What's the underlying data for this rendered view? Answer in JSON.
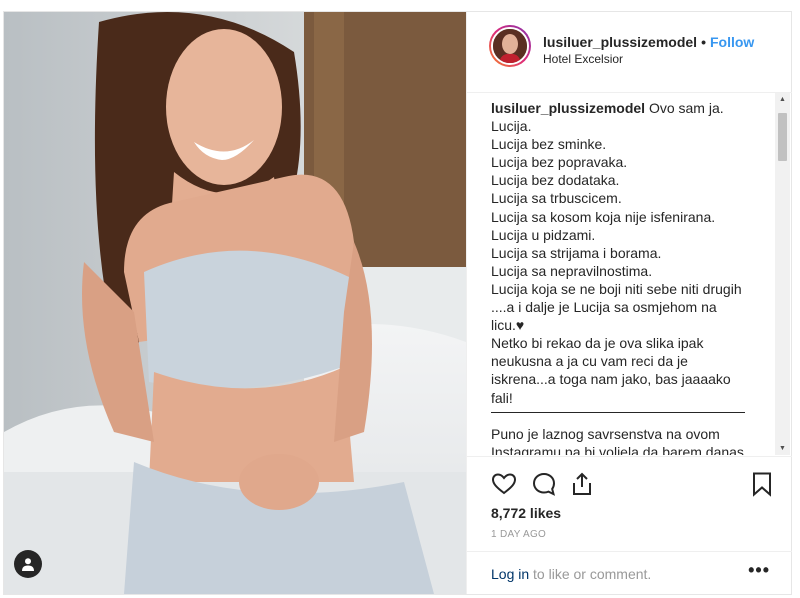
{
  "post": {
    "username": "lusiluer_plussizemodel",
    "separator": "•",
    "follow_label": "Follow",
    "location": "Hotel Excelsior",
    "caption_intro": "Ovo sam ja.",
    "caption_lines": [
      "Lucija.",
      "Lucija bez sminke.",
      "Lucija bez popravaka.",
      "Lucija bez dodataka.",
      "Lucija sa trbuscicem.",
      "Lucija sa kosom koja nije isfenirana.",
      "Lucija u pidzami.",
      "Lucija sa strijama i borama.",
      "Lucija sa nepravilnostima.",
      "Lucija koja se ne boji niti sebe niti drugih",
      "....a i dalje je Lucija sa osmjehom na licu.♥",
      "Netko bi rekao da je ova slika ipak neukusna a ja cu vam reci da je iskrena...a toga nam jako, bas jaaaako fali!"
    ],
    "caption_after_rule": "Puno je laznog savrsenstva na ovom Instagramu pa bi voljela da barem danas uzmete malo iskrene i sretne energije...da vas inspirira i opusti.",
    "likes": "8,772 likes",
    "time_ago": "1 DAY AGO",
    "login_link": "Log in",
    "login_rest": " to like or comment.",
    "more_label": "•••"
  },
  "icons": {
    "like": "heart-icon",
    "comment": "comment-icon",
    "share": "share-icon",
    "save": "bookmark-icon",
    "user_tag": "user-icon"
  },
  "colors": {
    "follow": "#3897f0",
    "text": "#262626",
    "muted": "#999999",
    "link": "#003569"
  }
}
